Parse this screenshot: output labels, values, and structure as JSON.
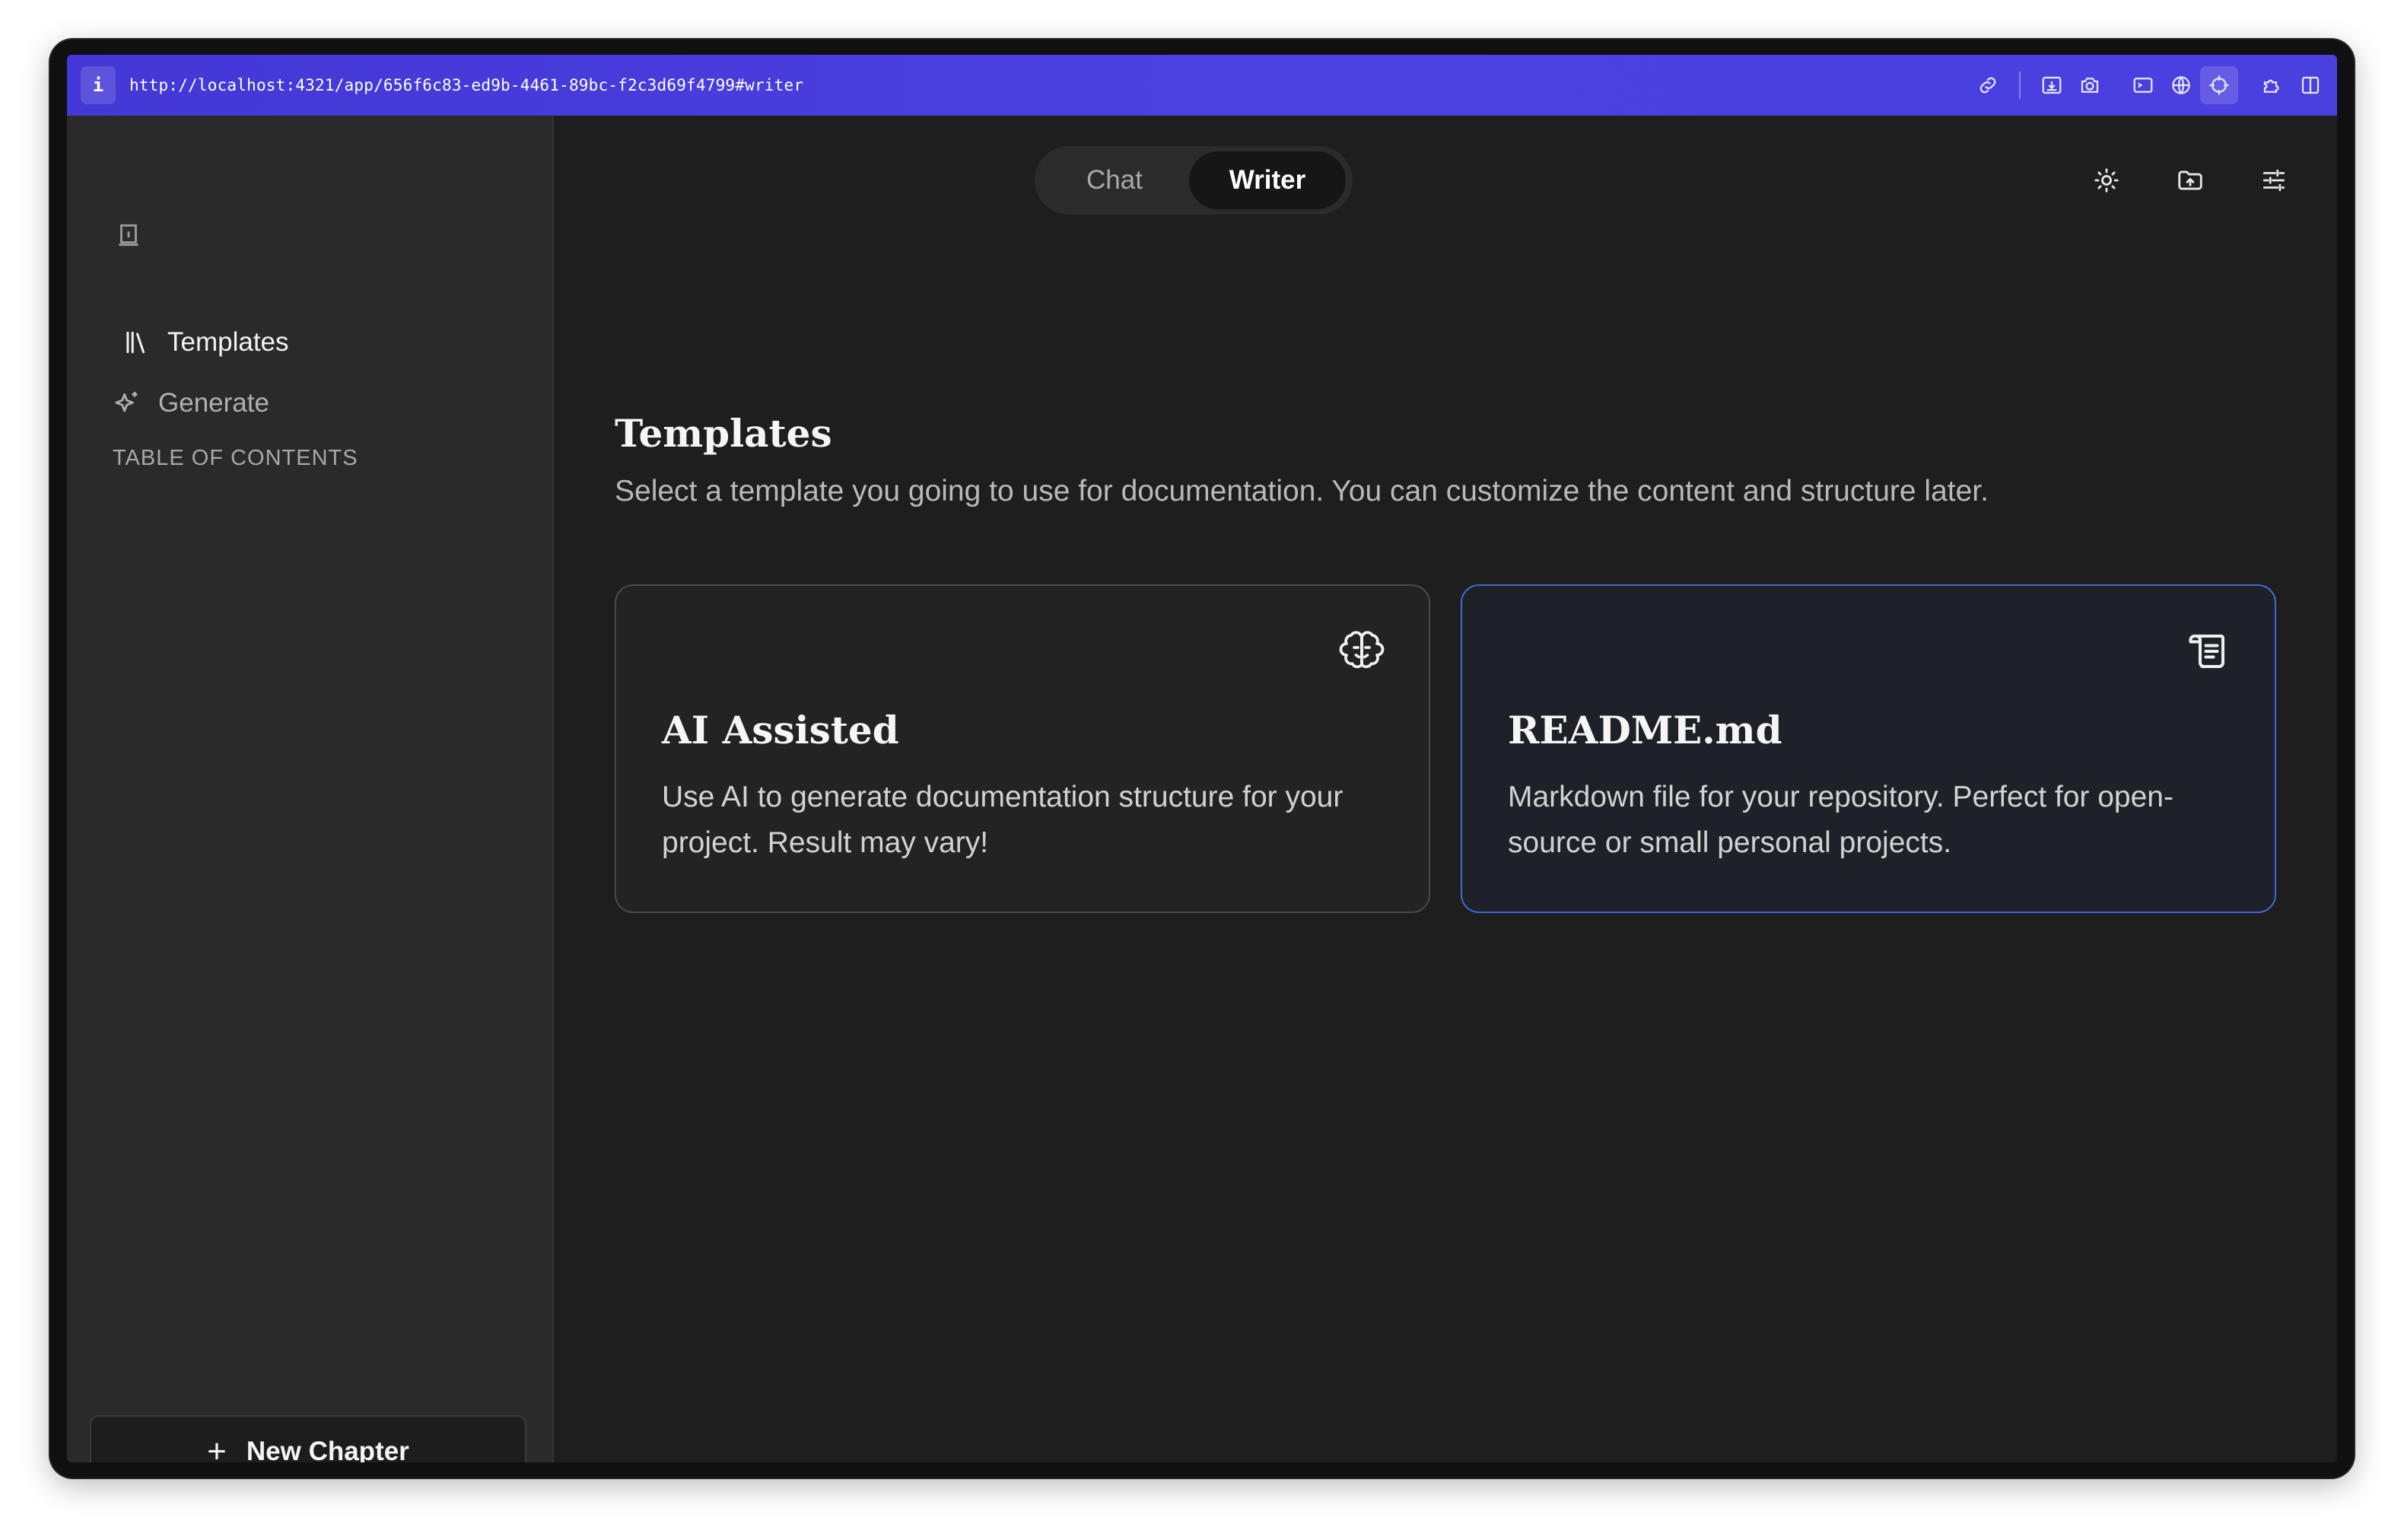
{
  "browser": {
    "info_label": "i",
    "url": "http://localhost:4321/app/656f6c83-ed9b-4461-89bc-f2c3d69f4799#writer",
    "tools": [
      "link-icon",
      "download-icon",
      "camera-icon",
      "terminal-icon",
      "globe-icon",
      "crosshair-icon",
      "puzzle-icon",
      "split-view-icon"
    ],
    "active_tool": "crosshair-icon"
  },
  "sidebar": {
    "toggle_icon": "sidebar-toggle-icon",
    "items": [
      {
        "label": "Templates",
        "icon": "library-icon",
        "active": true
      },
      {
        "label": "Generate",
        "icon": "sparkles-icon",
        "active": false
      }
    ],
    "toc_label": "TABLE OF CONTENTS",
    "new_chapter_label": "New Chapter"
  },
  "header": {
    "tabs": [
      {
        "label": "Chat",
        "active": false
      },
      {
        "label": "Writer",
        "active": true
      }
    ],
    "icons": [
      "sun-icon",
      "folder-upload-icon",
      "sliders-icon"
    ]
  },
  "main": {
    "title": "Templates",
    "subtitle": "Select a template you going to use for documentation. You can customize the content and structure later.",
    "cards": [
      {
        "title": "AI Assisted",
        "description": "Use AI to generate documentation structure for your project. Result may vary!",
        "icon": "brain-icon",
        "selected": false
      },
      {
        "title": "README.md",
        "description": "Markdown file for your repository. Perfect for open-source or small personal projects.",
        "icon": "scroll-icon",
        "selected": true
      }
    ]
  },
  "colors": {
    "urlbar": "#4338d6",
    "sidebar_bg": "#2a2a2a",
    "main_bg": "#1e1e1e",
    "selected_border": "#3e6ad2"
  }
}
